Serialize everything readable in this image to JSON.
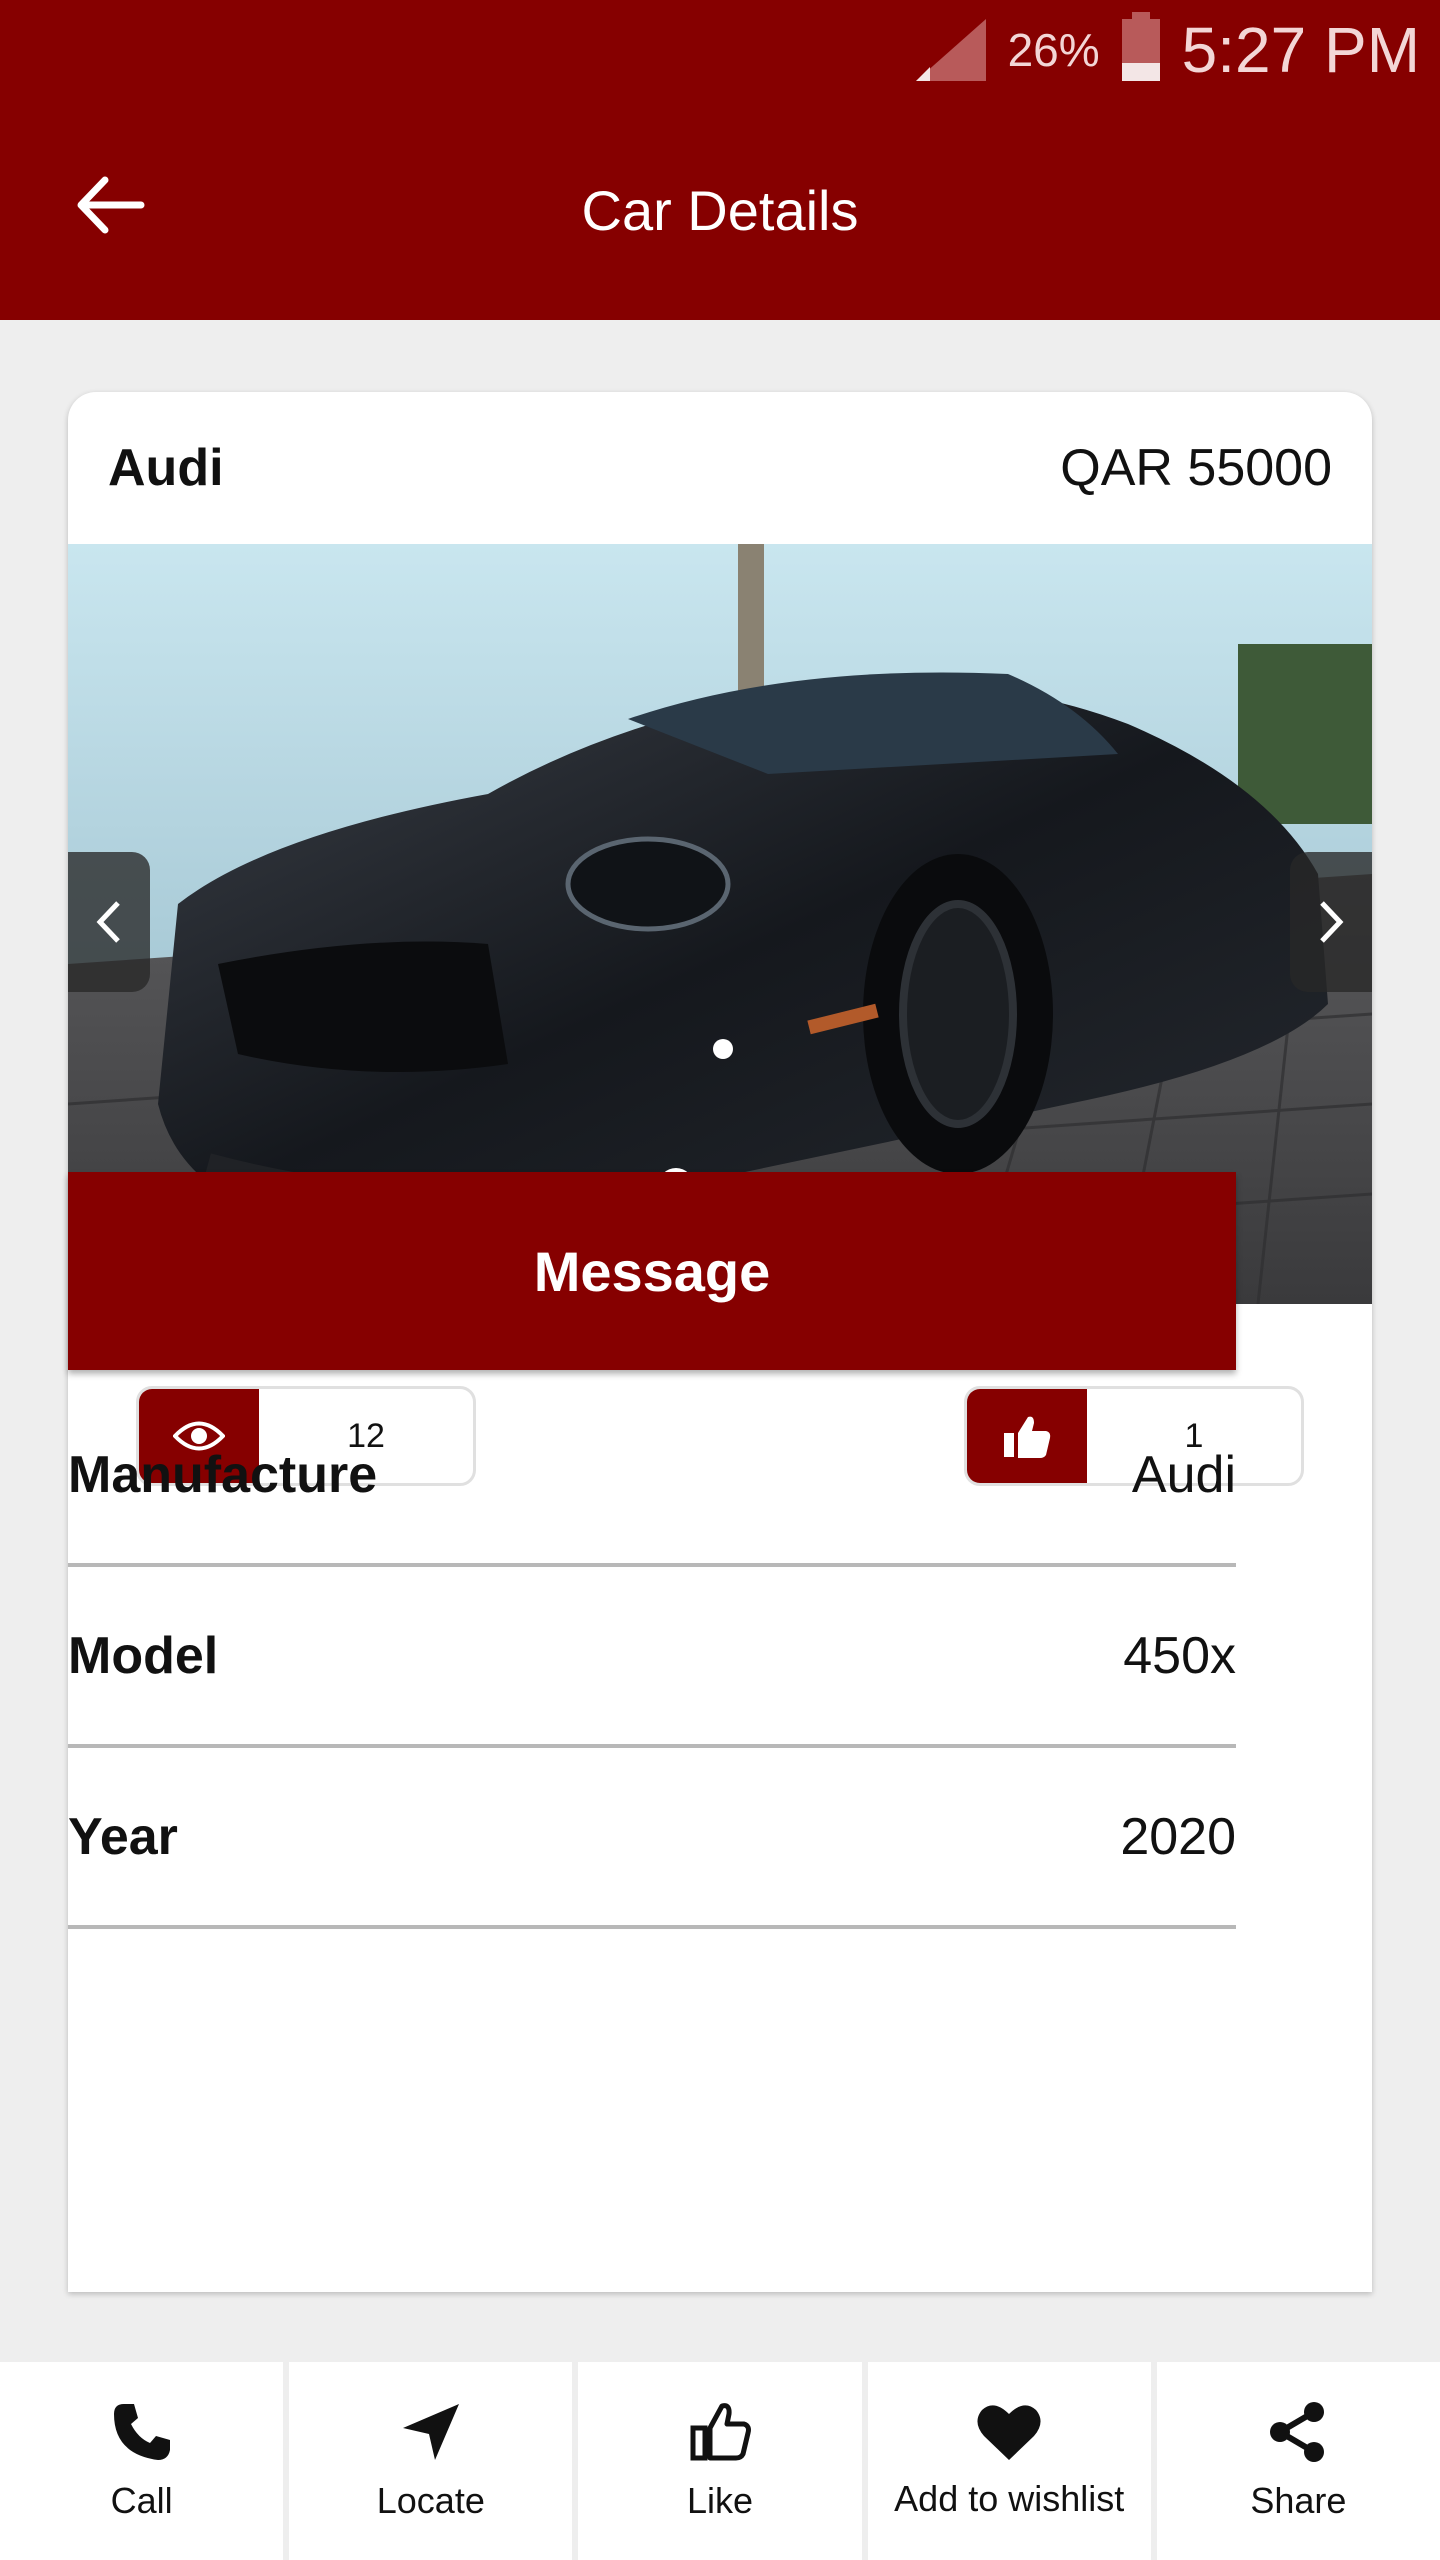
{
  "status_bar": {
    "battery": "26%",
    "time": "5:27 PM"
  },
  "app_bar": {
    "title": "Car Details",
    "back_icon": "arrow-left-icon"
  },
  "car": {
    "name": "Audi",
    "price": "QAR 55000"
  },
  "gallery": {
    "image_count": 3,
    "active_index": 0
  },
  "stats": {
    "views": "12",
    "likes": "1"
  },
  "actions": {
    "message_label": "Message"
  },
  "specs": [
    {
      "label": "Manufacture",
      "value": "Audi"
    },
    {
      "label": "Model",
      "value": "450x"
    },
    {
      "label": "Year",
      "value": "2020"
    }
  ],
  "bottom_nav": [
    {
      "label": "Call",
      "icon": "phone-icon"
    },
    {
      "label": "Locate",
      "icon": "navigation-arrow-icon"
    },
    {
      "label": "Like",
      "icon": "thumbs-up-icon"
    },
    {
      "label": "Add to wishlist",
      "icon": "heart-icon"
    },
    {
      "label": "Share",
      "icon": "share-icon"
    }
  ],
  "colors": {
    "brand": "#860000",
    "background": "#eeeeee",
    "card": "#ffffff"
  }
}
